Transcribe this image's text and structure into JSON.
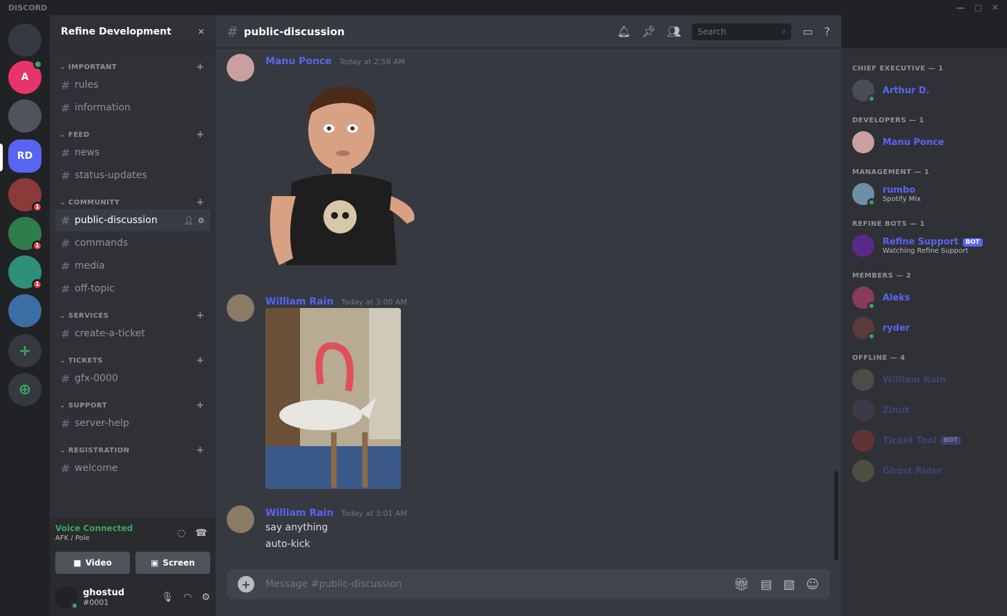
{
  "app": {
    "title": "DISCORD"
  },
  "window_controls": {
    "min": "—",
    "max": "▢",
    "close": "✕"
  },
  "rail": {
    "servers": [
      {
        "abbr": "",
        "color": "#36393f",
        "icon": "discord-home-icon"
      },
      {
        "abbr": "A",
        "color": "#e8336b",
        "icon": "server-a-icon"
      },
      {
        "abbr": "",
        "color": "#4f545c",
        "icon": "server-photo-icon"
      },
      {
        "abbr": "RD",
        "color": "#5865f2",
        "icon": "refine-dev-server-icon"
      },
      {
        "abbr": "",
        "color": "#8b3a3a",
        "icon": "server-folder-icon",
        "badge": "1"
      },
      {
        "abbr": "",
        "color": "#2f7d4a",
        "icon": "server-folder-icon",
        "badge": "1"
      },
      {
        "abbr": "",
        "color": "#2f8f7a",
        "icon": "server-folder-icon",
        "badge": "1"
      },
      {
        "abbr": "",
        "color": "#3b6ea5",
        "icon": "server-folder-icon"
      }
    ],
    "add_label": "+",
    "explore_label": "⊕"
  },
  "sidebar": {
    "guild_name": "Refine Development",
    "categories": [
      {
        "name": "IMPORTANT",
        "channels": [
          {
            "name": "rules"
          },
          {
            "name": "information"
          }
        ]
      },
      {
        "name": "FEED",
        "channels": [
          {
            "name": "news"
          },
          {
            "name": "status-updates"
          }
        ]
      },
      {
        "name": "COMMUNITY",
        "channels": [
          {
            "name": "public-discussion",
            "active": true
          },
          {
            "name": "commands"
          },
          {
            "name": "media"
          },
          {
            "name": "off-topic"
          }
        ]
      },
      {
        "name": "SERVICES",
        "channels": [
          {
            "name": "create-a-ticket"
          }
        ]
      },
      {
        "name": "TICKETS",
        "channels": [
          {
            "name": "gfx-0000"
          }
        ]
      },
      {
        "name": "SUPPORT",
        "channels": [
          {
            "name": "server-help"
          }
        ]
      },
      {
        "name": "REGISTRATION",
        "channels": [
          {
            "name": "welcome"
          }
        ]
      }
    ],
    "voice": {
      "status": "Voice Connected",
      "sub": "AFK / Pole",
      "video": "Video",
      "screen": "Screen"
    },
    "user": {
      "name": "ghostud",
      "tag": "#0001"
    }
  },
  "chat": {
    "channel_name": "public-discussion",
    "search_placeholder": "Search",
    "composer_placeholder": "Message #public-discussion",
    "messages": [
      {
        "author": "Manu Ponce",
        "time": "Today at 2:58 AM",
        "lines": [],
        "avatar_color": "#c9a0a0"
      },
      {
        "author": "William Rain",
        "time": "Today at 3:00 AM",
        "lines": [],
        "avatar_color": "#8a7a66"
      },
      {
        "author": "William Rain",
        "time": "Today at 3:01 AM",
        "lines": [
          "say anything",
          "auto-kick"
        ],
        "avatar_color": "#8a7a66"
      }
    ]
  },
  "members": {
    "groups": [
      {
        "name": "CHIEF EXECUTIVE — 1",
        "members": [
          {
            "name": "Arthur D.",
            "sub": "",
            "color": "#4a4d53",
            "status": true
          }
        ]
      },
      {
        "name": "DEVELOPERS — 1",
        "members": [
          {
            "name": "Manu Ponce",
            "sub": "",
            "color": "#c9a0a0",
            "status": false
          }
        ]
      },
      {
        "name": "MANAGEMENT — 1",
        "members": [
          {
            "name": "rumbo",
            "sub": "Spotify Mix",
            "color": "#6e8fa8",
            "status": true
          }
        ]
      },
      {
        "name": "REFINE BOTS — 1",
        "members": [
          {
            "name": "Refine Support",
            "sub": "Watching Refine Support",
            "color": "#5a2a8a",
            "status": false,
            "bot": "BOT"
          }
        ]
      },
      {
        "name": "MEMBERS — 2",
        "members": [
          {
            "name": "Aleks",
            "sub": "",
            "color": "#8a3a5a",
            "status": true
          },
          {
            "name": "ryder",
            "sub": "",
            "color": "#5a3a3a",
            "status": true
          }
        ]
      },
      {
        "name": "OFFLINE — 4",
        "offline": true,
        "members": [
          {
            "name": "William Rain",
            "sub": "",
            "color": "#8a7a66"
          },
          {
            "name": "Zinut",
            "sub": "",
            "color": "#5a4a6a"
          },
          {
            "name": "Ticket Tool",
            "sub": "",
            "color": "#c03a3a",
            "bot": "BOT"
          },
          {
            "name": "Ghost Rider",
            "sub": "",
            "color": "#8a8a5a"
          }
        ]
      }
    ]
  }
}
